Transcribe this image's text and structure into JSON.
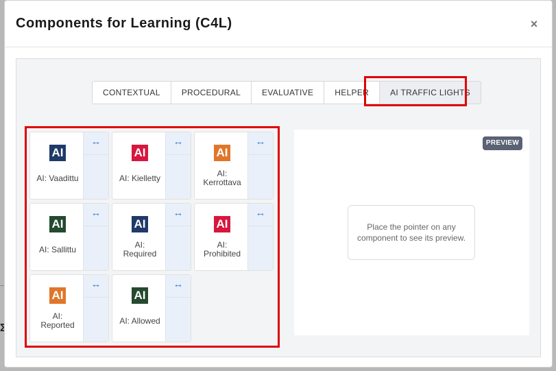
{
  "modal": {
    "title": "Components for Learning (C4L)",
    "close_label": "×"
  },
  "tabs": [
    {
      "label": "CONTEXTUAL"
    },
    {
      "label": "PROCEDURAL"
    },
    {
      "label": "EVALUATIVE"
    },
    {
      "label": "HELPER"
    },
    {
      "label": "AI TRAFFIC LIGHTS",
      "active": true
    }
  ],
  "components": [
    {
      "badge": "AI",
      "color": "#1f3a68",
      "label_lines": [
        "AI: Vaadittu"
      ]
    },
    {
      "badge": "AI",
      "color": "#d8163e",
      "label_lines": [
        "AI: Kielletty"
      ]
    },
    {
      "badge": "AI",
      "color": "#e0762a",
      "label_lines": [
        "AI:",
        "Kerrottava"
      ]
    },
    {
      "badge": "AI",
      "color": "#244a30",
      "label_lines": [
        "AI: Sallittu"
      ]
    },
    {
      "badge": "AI",
      "color": "#1f3a68",
      "label_lines": [
        "AI:",
        "Required"
      ]
    },
    {
      "badge": "AI",
      "color": "#d8163e",
      "label_lines": [
        "AI:",
        "Prohibited"
      ]
    },
    {
      "badge": "AI",
      "color": "#e0762a",
      "label_lines": [
        "AI:",
        "Reported"
      ]
    },
    {
      "badge": "AI",
      "color": "#244a30",
      "label_lines": [
        "AI: Allowed"
      ]
    }
  ],
  "expand_icon": "↔",
  "preview": {
    "badge": "PREVIEW",
    "hint": "Place the pointer on any component to see its preview."
  },
  "background": {
    "glyph": "Σ"
  }
}
